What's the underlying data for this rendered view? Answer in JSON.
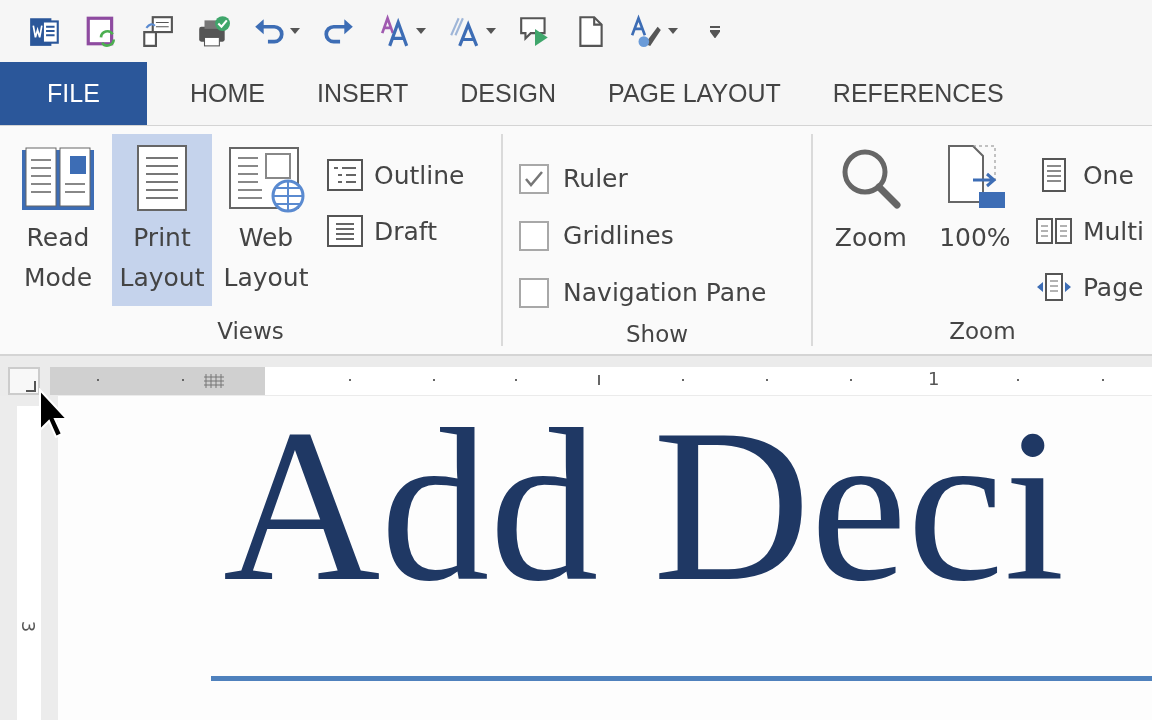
{
  "tabs": [
    {
      "label": "FILE",
      "kind": "file",
      "selected": false
    },
    {
      "label": "HOME",
      "kind": "tab",
      "selected": false
    },
    {
      "label": "INSERT",
      "kind": "tab",
      "selected": false
    },
    {
      "label": "DESIGN",
      "kind": "tab",
      "selected": false
    },
    {
      "label": "PAGE LAYOUT",
      "kind": "tab",
      "selected": false
    },
    {
      "label": "REFERENCES",
      "kind": "tab",
      "selected": false
    }
  ],
  "ribbon": {
    "groups": [
      {
        "label": "Views",
        "large": [
          {
            "label": "Read Mode",
            "selected": false
          },
          {
            "label": "Print Layout",
            "selected": true
          },
          {
            "label": "Web Layout",
            "selected": false
          }
        ],
        "small": [
          {
            "label": "Outline"
          },
          {
            "label": "Draft"
          }
        ]
      },
      {
        "label": "Show",
        "checkboxes": [
          {
            "label": "Ruler",
            "checked": true
          },
          {
            "label": "Gridlines",
            "checked": false
          },
          {
            "label": "Navigation Pane",
            "checked": false
          }
        ]
      },
      {
        "label": "Zoom",
        "large": [
          {
            "label": "Zoom",
            "selected": false
          },
          {
            "label": "100%",
            "selected": false
          }
        ],
        "small": [
          {
            "label": "One"
          },
          {
            "label": "Multi"
          },
          {
            "label": "Page"
          }
        ]
      }
    ]
  },
  "ruler": {
    "horizontal_label": "1",
    "vertical_label": "3"
  },
  "document": {
    "title": "Add Deci"
  }
}
